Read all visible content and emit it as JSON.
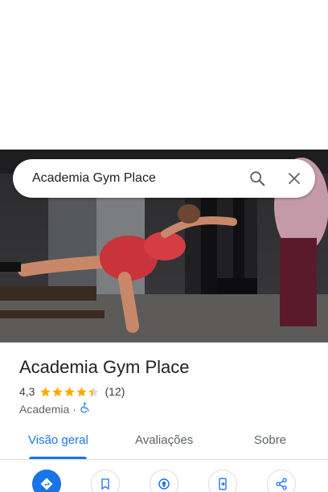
{
  "search": {
    "query": "Academia Gym Place"
  },
  "place": {
    "name": "Academia Gym Place",
    "rating": "4,3",
    "rating_value": 4.3,
    "review_count": "(12)",
    "category": "Academia",
    "separator": "·"
  },
  "tabs": [
    {
      "label": "Visão geral",
      "active": true
    },
    {
      "label": "Avaliações",
      "active": false
    },
    {
      "label": "Sobre",
      "active": false
    }
  ],
  "actions": [
    {
      "icon": "directions-icon"
    },
    {
      "icon": "save-icon"
    },
    {
      "icon": "nearby-icon"
    },
    {
      "icon": "send-to-phone-icon"
    },
    {
      "icon": "share-icon"
    }
  ],
  "colors": {
    "accent": "#1a73e8",
    "star": "#f9ab00"
  }
}
